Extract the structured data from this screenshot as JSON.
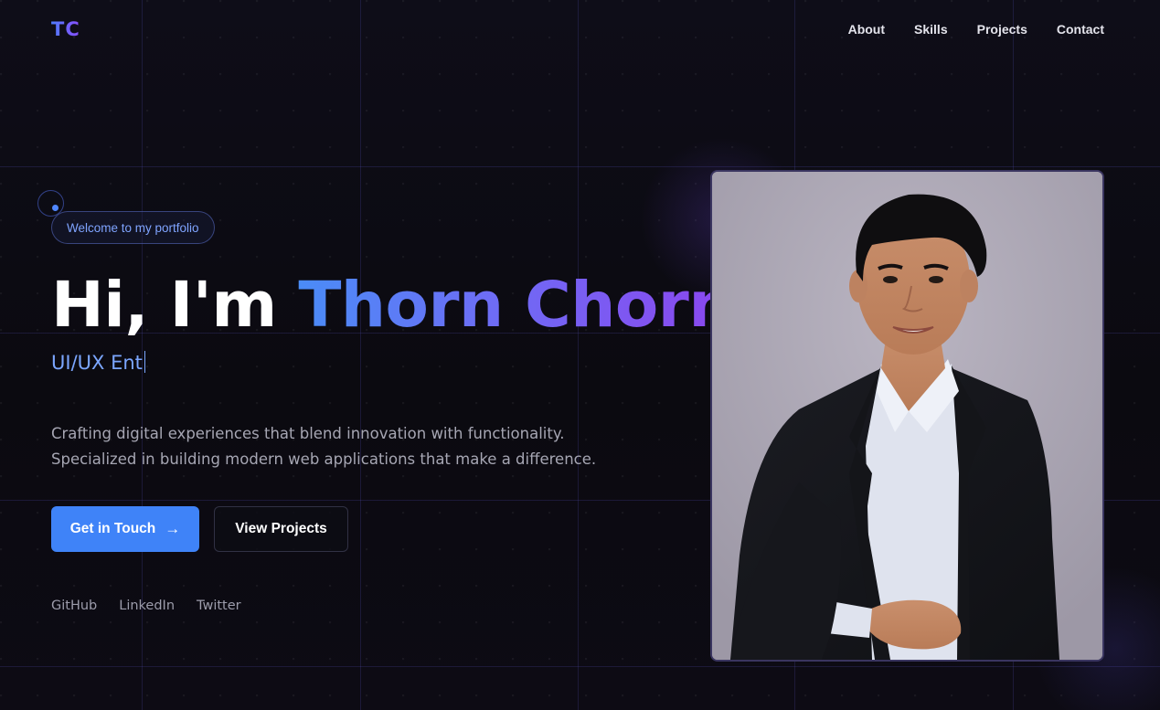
{
  "nav": {
    "logo": "TC",
    "items": [
      {
        "label": "About"
      },
      {
        "label": "Skills"
      },
      {
        "label": "Projects"
      },
      {
        "label": "Contact"
      }
    ]
  },
  "hero": {
    "badge": "Welcome to my portfolio",
    "greeting": "Hi, I'm ",
    "name": "Thorn Chorn",
    "role_typed": "UI/UX Ent",
    "description_line1": "Crafting digital experiences that blend innovation with functionality.",
    "description_line2": "Specialized in building modern web applications that make a difference.",
    "primary_button": "Get in Touch",
    "primary_button_icon": "→",
    "secondary_button": "View Projects",
    "socials": [
      {
        "label": "GitHub"
      },
      {
        "label": "LinkedIn"
      },
      {
        "label": "Twitter"
      }
    ]
  },
  "photo": {
    "subject": "portrait photo"
  },
  "colors": {
    "accent_blue": "#3f83f8",
    "accent_purple": "#8b46ee",
    "background": "#0c0b12"
  }
}
